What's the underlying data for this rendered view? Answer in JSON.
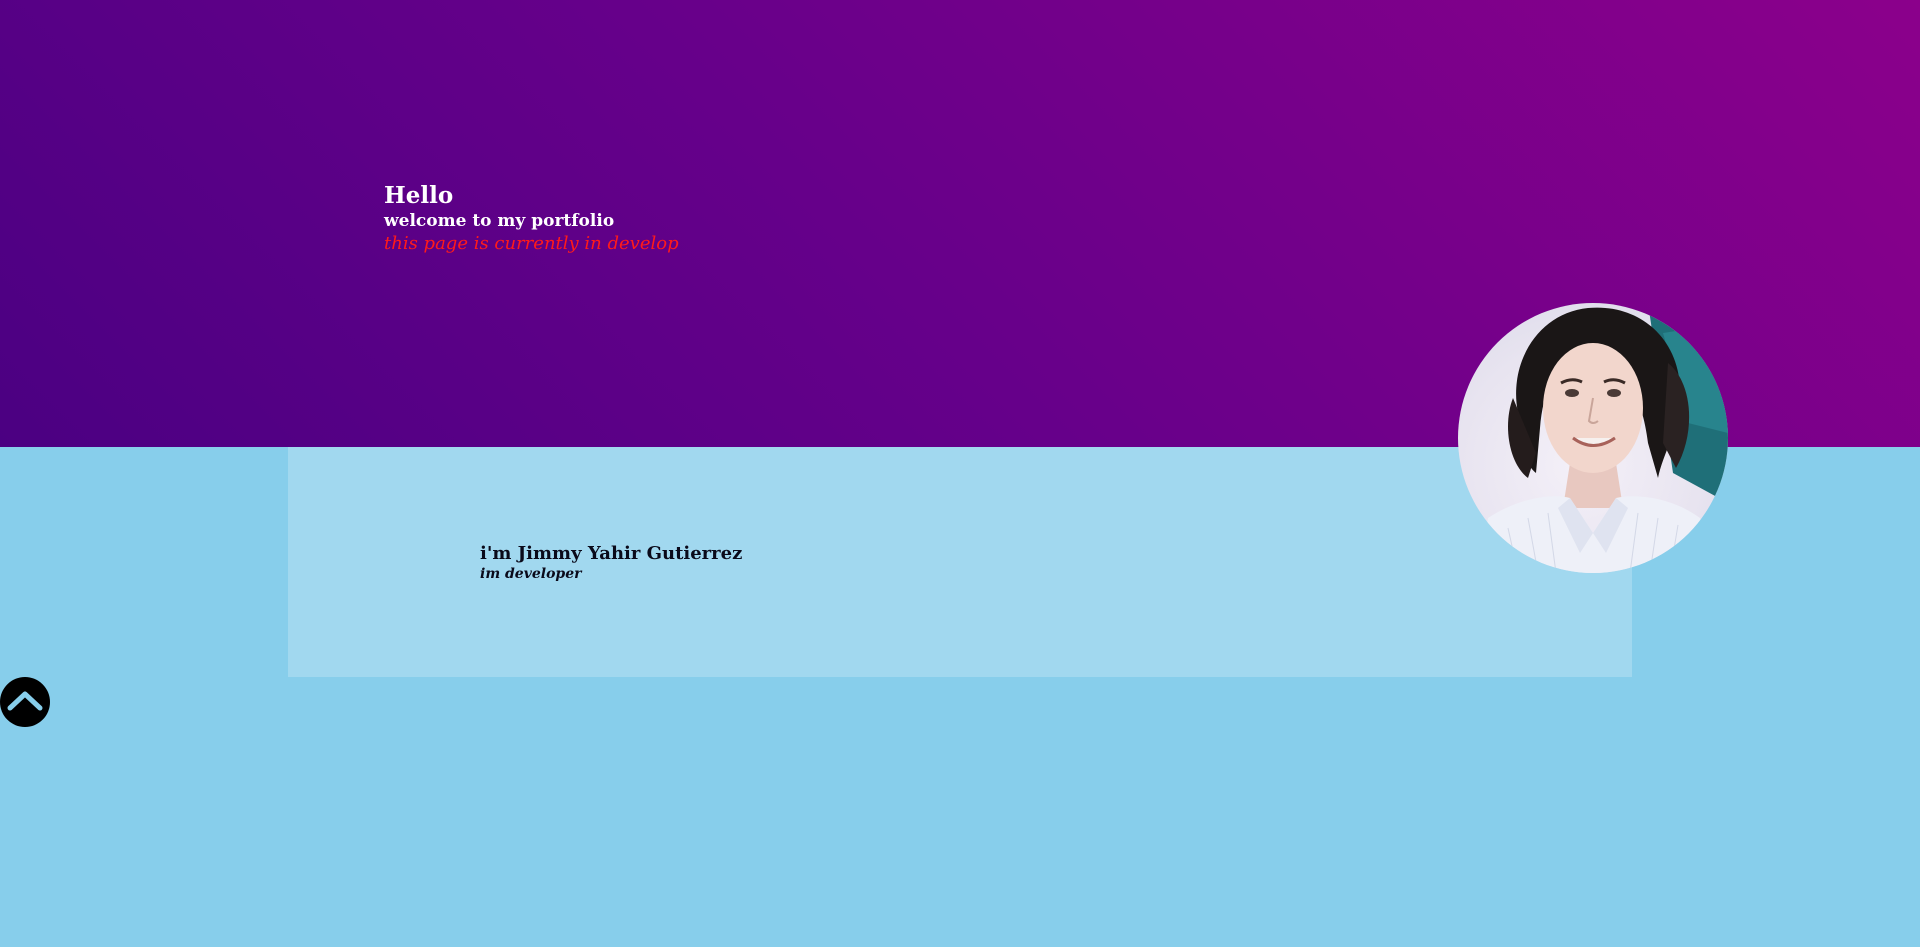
{
  "hero": {
    "greeting": "Hello",
    "welcome": "welcome to my portfolio",
    "notice": "this page is currently in develop"
  },
  "about": {
    "name": "i'm Jimmy Yahir Gutierrez",
    "role": "im developer"
  },
  "avatar": {
    "kind": "profile-photo"
  },
  "scroll_top": {
    "icon": "chevron-up-icon"
  },
  "colors": {
    "hero_gradient_start": "#4b0082",
    "hero_gradient_end": "#8b008b",
    "page_background": "#87ceeb",
    "card_background": "#a1d8ef",
    "notice_text": "#ff1a1a"
  }
}
